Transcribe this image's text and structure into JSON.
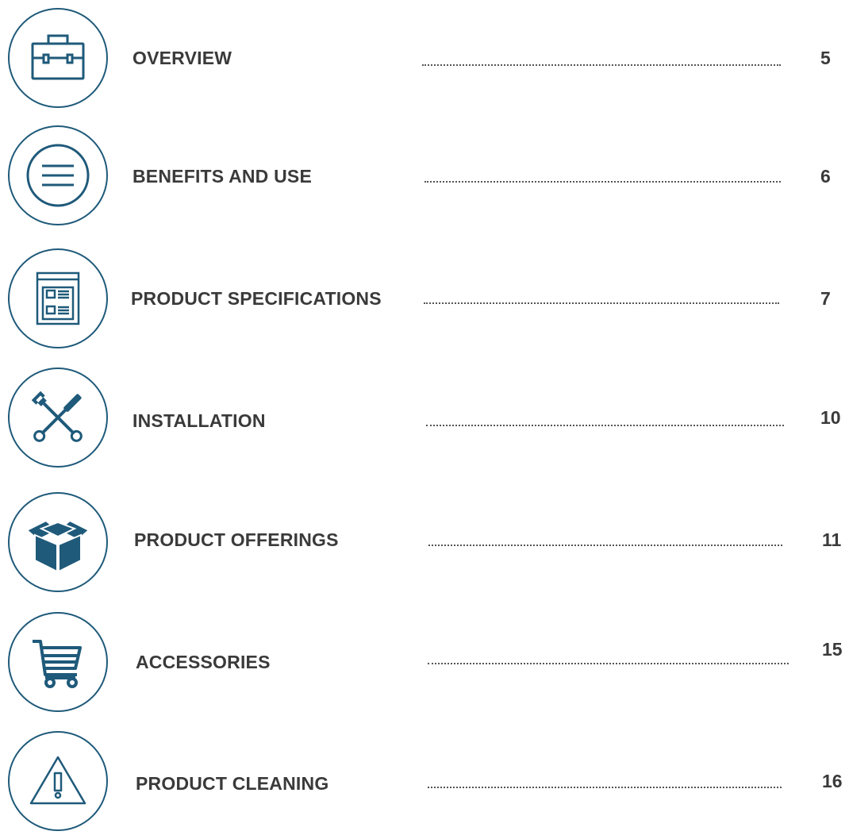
{
  "accent_color": "#1f5a7a",
  "text_color": "#3a3a3a",
  "entries": [
    {
      "title": "OVERVIEW",
      "page": "5",
      "icon": "briefcase-icon"
    },
    {
      "title": "BENEFITS AND USE",
      "page": "6",
      "icon": "menu-lines-icon"
    },
    {
      "title": "PRODUCT SPECIFICATIONS",
      "page": "7",
      "icon": "spec-sheet-icon"
    },
    {
      "title": "INSTALLATION",
      "page": "10",
      "icon": "wrench-screwdriver-icon"
    },
    {
      "title": "PRODUCT OFFERINGS",
      "page": "11",
      "icon": "box-icon"
    },
    {
      "title": "ACCESSORIES",
      "page": "15",
      "icon": "shopping-cart-icon"
    },
    {
      "title": "PRODUCT CLEANING",
      "page": "16",
      "icon": "warning-icon"
    }
  ]
}
